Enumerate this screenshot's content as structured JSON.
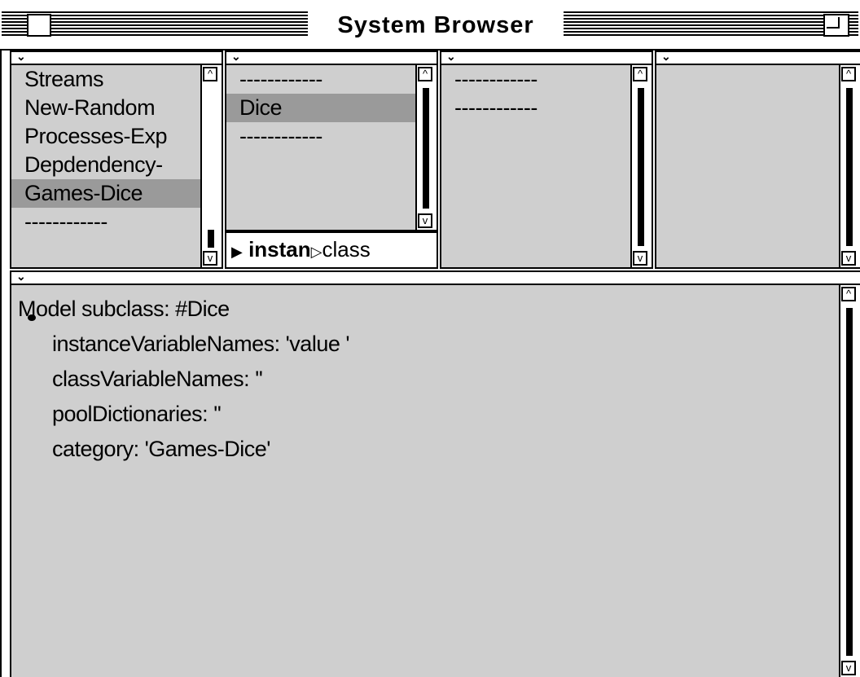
{
  "window": {
    "title": "System Browser"
  },
  "categories_pane": {
    "items": [
      "Streams",
      "New-Random",
      "Processes-Exp",
      "Depdendency-",
      "Games-Dice",
      "------------"
    ],
    "selected_index": 4
  },
  "classes_pane": {
    "items": [
      "------------",
      "Dice",
      "------------"
    ],
    "selected_index": 1,
    "instance_label": "instan",
    "class_label": "class"
  },
  "protocols_pane": {
    "items": [
      "------------",
      "------------"
    ]
  },
  "methods_pane": {
    "items": []
  },
  "code_pane": {
    "lines": [
      "Model subclass: #Dice",
      "      instanceVariableNames: 'value '",
      "      classVariableNames: ''",
      "      poolDictionaries: ''",
      "      category: 'Games-Dice'"
    ]
  },
  "icons": {
    "pane_menu": "chevron-down-icon",
    "scroll_up": "arrow-up-icon",
    "scroll_down": "arrow-down-icon"
  }
}
